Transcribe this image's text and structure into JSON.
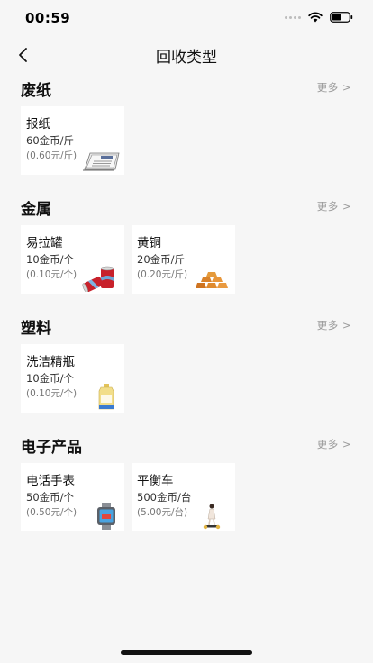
{
  "status": {
    "time": "00:59"
  },
  "nav": {
    "title": "回收类型"
  },
  "sections": [
    {
      "title": "废纸",
      "more": "更多 >",
      "items": [
        {
          "name": "报纸",
          "coins": "60金币/斤",
          "price": "(0.60元/斤)",
          "icon": "newspaper-icon"
        }
      ]
    },
    {
      "title": "金属",
      "more": "更多 >",
      "items": [
        {
          "name": "易拉罐",
          "coins": "10金币/个",
          "price": "(0.10元/个)",
          "icon": "cans-icon"
        },
        {
          "name": "黄铜",
          "coins": "20金币/斤",
          "price": "(0.20元/斤)",
          "icon": "brass-bars-icon"
        }
      ]
    },
    {
      "title": "塑料",
      "more": "更多 >",
      "items": [
        {
          "name": "洗洁精瓶",
          "coins": "10金币/个",
          "price": "(0.10元/个)",
          "icon": "detergent-bottle-icon"
        }
      ]
    },
    {
      "title": "电子产品",
      "more": "更多 >",
      "items": [
        {
          "name": "电话手表",
          "coins": "50金币/个",
          "price": "(0.50元/个)",
          "icon": "smartwatch-icon"
        },
        {
          "name": "平衡车",
          "coins": "500金币/台",
          "price": "(5.00元/台)",
          "icon": "balance-scooter-icon"
        }
      ]
    }
  ]
}
